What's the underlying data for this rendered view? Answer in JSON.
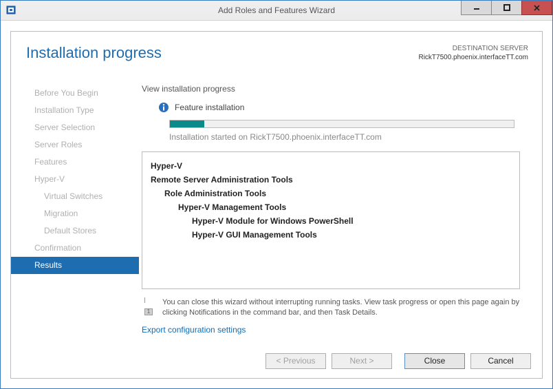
{
  "window": {
    "title": "Add Roles and Features Wizard"
  },
  "header": {
    "heading": "Installation progress",
    "destLabel": "DESTINATION SERVER",
    "destValue": "RickT7500.phoenix.interfaceTT.com"
  },
  "sidebar": {
    "items": [
      {
        "label": "Before You Begin",
        "selected": false,
        "sub": false
      },
      {
        "label": "Installation Type",
        "selected": false,
        "sub": false
      },
      {
        "label": "Server Selection",
        "selected": false,
        "sub": false
      },
      {
        "label": "Server Roles",
        "selected": false,
        "sub": false
      },
      {
        "label": "Features",
        "selected": false,
        "sub": false
      },
      {
        "label": "Hyper-V",
        "selected": false,
        "sub": false
      },
      {
        "label": "Virtual Switches",
        "selected": false,
        "sub": true
      },
      {
        "label": "Migration",
        "selected": false,
        "sub": true
      },
      {
        "label": "Default Stores",
        "selected": false,
        "sub": true
      },
      {
        "label": "Confirmation",
        "selected": false,
        "sub": false
      },
      {
        "label": "Results",
        "selected": true,
        "sub": false
      }
    ]
  },
  "progress": {
    "viewHeading": "View installation progress",
    "statusText": "Feature installation",
    "percent": 10,
    "message": "Installation started on RickT7500.phoenix.interfaceTT.com"
  },
  "tree": {
    "items": [
      {
        "level": 0,
        "text": "Hyper-V"
      },
      {
        "level": 0,
        "text": "Remote Server Administration Tools"
      },
      {
        "level": 1,
        "text": "Role Administration Tools"
      },
      {
        "level": 2,
        "text": "Hyper-V Management Tools"
      },
      {
        "level": 3,
        "text": "Hyper-V Module for Windows PowerShell"
      },
      {
        "level": 3,
        "text": "Hyper-V GUI Management Tools"
      }
    ]
  },
  "note": {
    "text": "You can close this wizard without interrupting running tasks. View task progress or open this page again by clicking Notifications in the command bar, and then Task Details."
  },
  "link": {
    "exportSettings": "Export configuration settings"
  },
  "footer": {
    "previous": "< Previous",
    "next": "Next >",
    "close": "Close",
    "cancel": "Cancel"
  }
}
